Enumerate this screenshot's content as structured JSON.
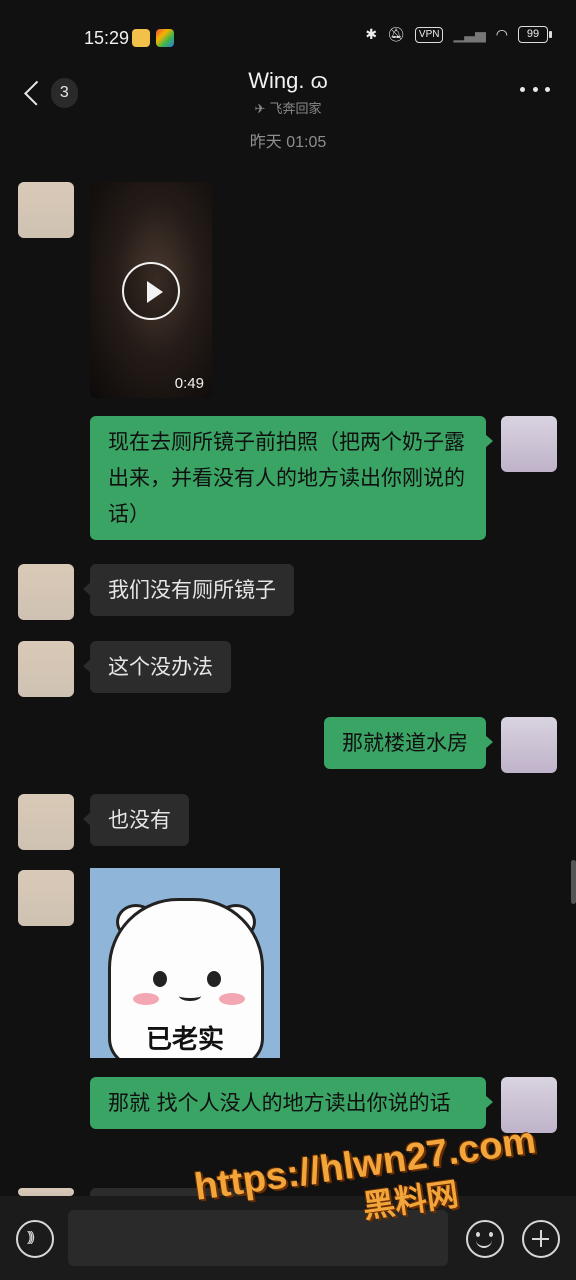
{
  "status_bar": {
    "time": "15:29",
    "vpn": "VPN",
    "battery": "99"
  },
  "header": {
    "unread_count": "3",
    "contact_name": "Wing. ɷ",
    "contact_status": "飞奔回家"
  },
  "chat_time": "昨天 01:05",
  "messages": {
    "video": {
      "duration": "0:49"
    },
    "m1": "现在去厕所镜子前拍照（把两个奶子露出来，并看没有人的地方读出你刚说的话）",
    "m2": "我们没有厕所镜子",
    "m3": "这个没办法",
    "m4": "那就楼道水房",
    "m5": "也没有",
    "sticker": {
      "text": "已老实"
    },
    "m6": "那就 找个人没人的地方读出你说的话"
  },
  "watermark": {
    "url": "https://hlwn27.com",
    "name": "黑料网"
  },
  "colors": {
    "background": "#111111",
    "bubble_sent": "#3aa465",
    "bubble_received": "#2c2c2c",
    "watermark": "#f2a53a"
  }
}
